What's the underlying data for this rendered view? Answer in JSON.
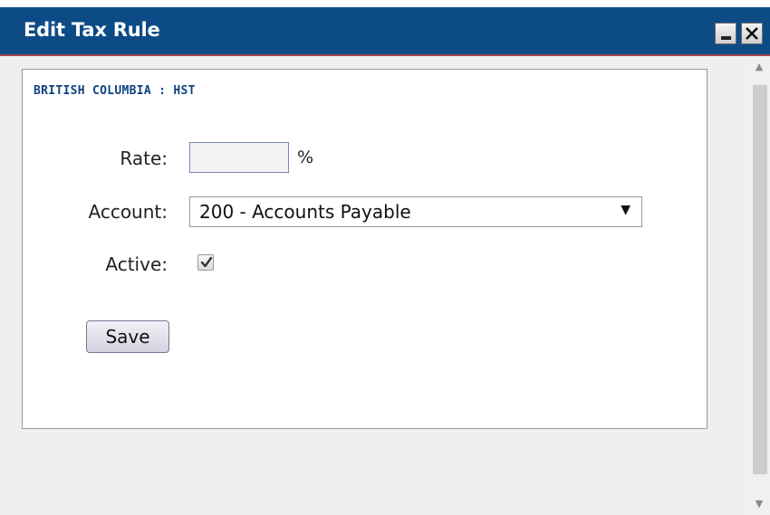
{
  "window": {
    "title": "Edit Tax Rule",
    "controls": {
      "minimize": "minimize",
      "close": "close"
    }
  },
  "form": {
    "heading": "BRITISH COLUMBIA : HST",
    "rate": {
      "label": "Rate:",
      "value": "",
      "unit": "%"
    },
    "account": {
      "label": "Account:",
      "selected": "200 - Accounts Payable",
      "arrow": "▼"
    },
    "active": {
      "label": "Active:",
      "checked": true
    },
    "save_label": "Save"
  },
  "scrollbar": {
    "up_arrow": "▲",
    "down_arrow": "▼"
  },
  "colors": {
    "titlebar": "#0d4b86",
    "heading": "#10447e",
    "panel_bg": "#ffffff",
    "window_bg": "#efefef"
  }
}
